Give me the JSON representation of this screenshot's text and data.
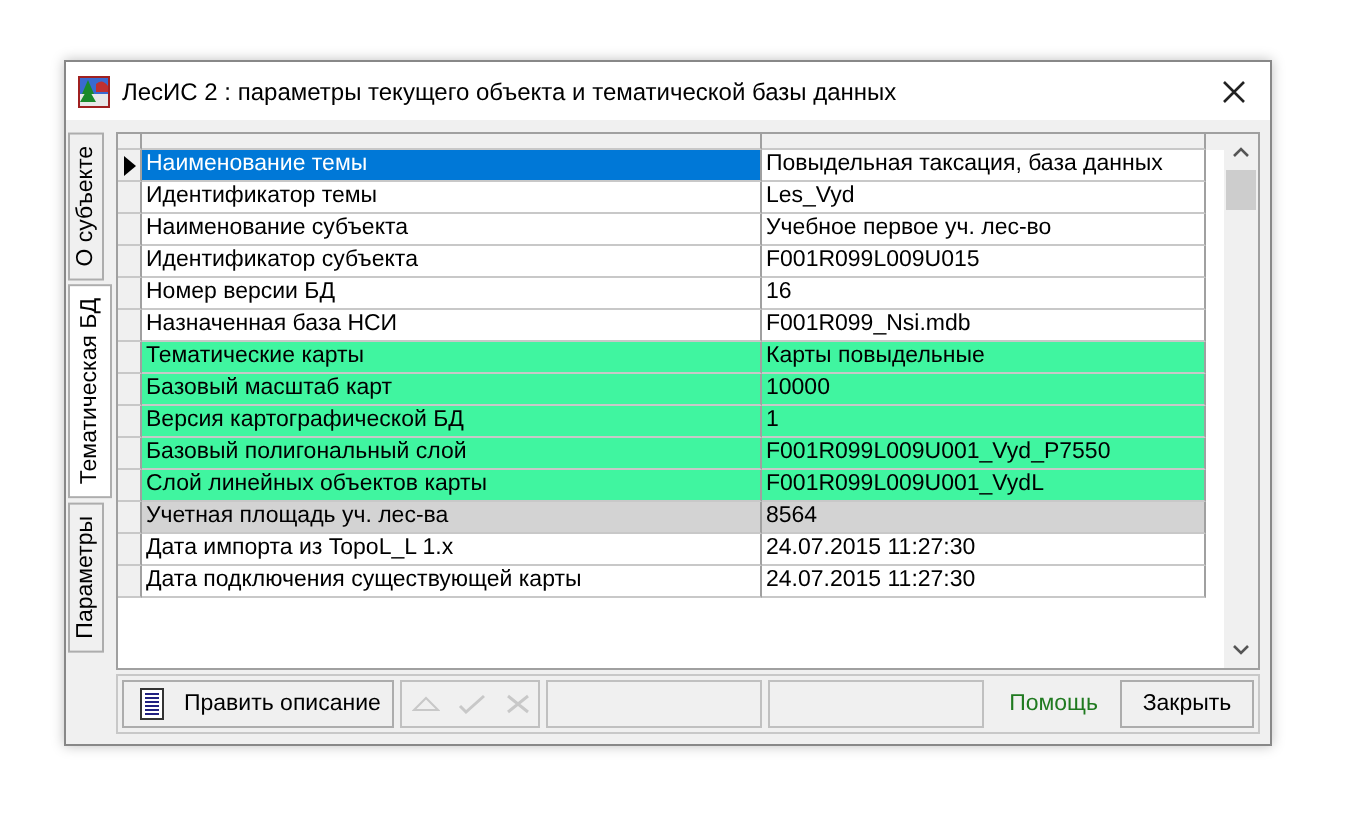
{
  "window": {
    "title": "ЛесИС 2 : параметры текущего объекта и тематической базы данных"
  },
  "tabs": [
    {
      "label": "О субъекте",
      "selected": false
    },
    {
      "label": "Тематическая БД",
      "selected": true
    },
    {
      "label": "Параметры",
      "selected": false
    }
  ],
  "table": {
    "rows": [
      {
        "name": "Наименование темы",
        "value": "Повыдельная таксация, база данных",
        "selected": true,
        "color": "#ffffff"
      },
      {
        "name": "Идентификатор темы",
        "value": "Les_Vyd",
        "selected": false,
        "color": "#ffffff"
      },
      {
        "name": "Наименование субъекта",
        "value": "Учебное первое уч. лес-во",
        "selected": false,
        "color": "#ffffff"
      },
      {
        "name": "Идентификатор субъекта",
        "value": "F001R099L009U015",
        "selected": false,
        "color": "#ffffff"
      },
      {
        "name": "Номер версии БД",
        "value": "16",
        "selected": false,
        "color": "#ffffff"
      },
      {
        "name": "Назначенная база НСИ",
        "value": "F001R099_Nsi.mdb",
        "selected": false,
        "color": "#ffffff"
      },
      {
        "name": "Тематические карты",
        "value": "Карты повыдельные",
        "selected": false,
        "color": "#40f5a0"
      },
      {
        "name": "Базовый масштаб карт",
        "value": "10000",
        "selected": false,
        "color": "#40f5a0"
      },
      {
        "name": "Версия картографической БД",
        "value": "1",
        "selected": false,
        "color": "#40f5a0"
      },
      {
        "name": "Базовый полигональный слой",
        "value": "F001R099L009U001_Vyd_P7550",
        "selected": false,
        "color": "#40f5a0"
      },
      {
        "name": "Слой линейных объектов карты",
        "value": "F001R099L009U001_VydL",
        "selected": false,
        "color": "#40f5a0"
      },
      {
        "name": "Учетная площадь уч. лес-ва",
        "value": "8564",
        "selected": false,
        "color": "#d3d3d3"
      },
      {
        "name": "Дата импорта из TopoL_L 1.x",
        "value": "24.07.2015 11:27:30",
        "selected": false,
        "color": "#ffffff"
      },
      {
        "name": "Дата подключения существующей карты",
        "value": "24.07.2015 11:27:30",
        "selected": false,
        "color": "#ffffff"
      }
    ]
  },
  "toolbar": {
    "edit_button": "Править описание",
    "help_link": "Помощь",
    "close_button": "Закрыть"
  }
}
